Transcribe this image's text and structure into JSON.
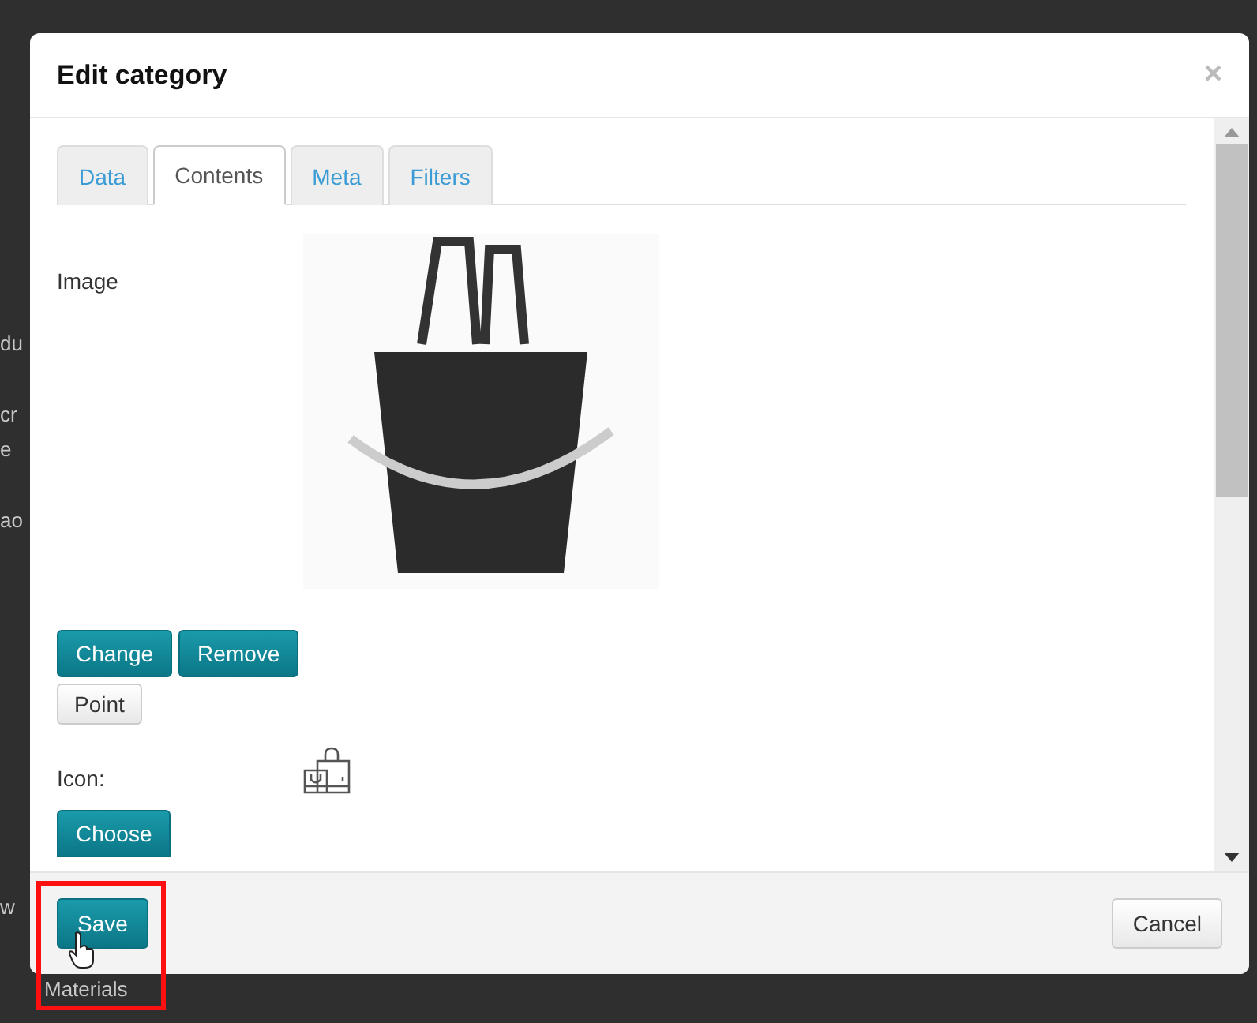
{
  "background_text": [
    "du",
    "cr",
    "e",
    "ao",
    "w",
    "Materials"
  ],
  "window": {
    "title": "Edit category",
    "close": "×"
  },
  "tabs": [
    {
      "label": "Data",
      "selected": false
    },
    {
      "label": "Contents",
      "selected": true
    },
    {
      "label": "Meta",
      "selected": false
    },
    {
      "label": "Filters",
      "selected": false
    }
  ],
  "image": {
    "label": "Image"
  },
  "image_buttons": [
    {
      "label": "Change",
      "kind": "primary"
    },
    {
      "label": "Remove",
      "kind": "primary"
    },
    {
      "label": "Point",
      "kind": "default"
    }
  ],
  "icon": {
    "label": "Icon:",
    "button": "Choose"
  },
  "footer": {
    "save": "Save",
    "cancel": "Cancel"
  }
}
